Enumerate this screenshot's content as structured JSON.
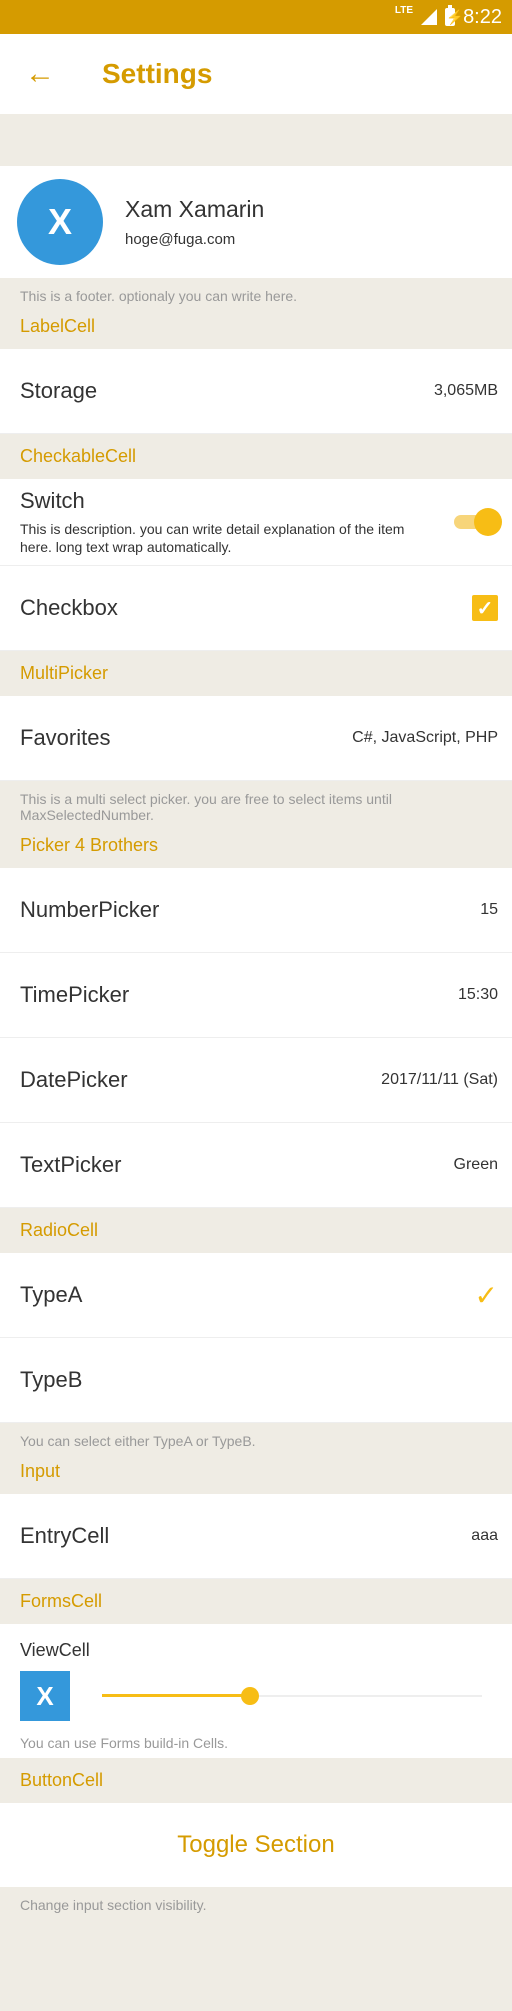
{
  "status": {
    "lte": "LTE",
    "time": "8:22"
  },
  "appbar": {
    "title": "Settings"
  },
  "profile": {
    "name": "Xam Xamarin",
    "email": "hoge@fuga.com",
    "logo_letter": "X",
    "footer": "This is a footer. optionaly you can write here."
  },
  "label_section": {
    "header": "LabelCell",
    "storage_label": "Storage",
    "storage_value": "3,065MB"
  },
  "checkable_section": {
    "header": "CheckableCell",
    "switch_label": "Switch",
    "switch_desc": "This is description. you can write detail explanation of the item here. long text wrap automatically.",
    "switch_on": true,
    "checkbox_label": "Checkbox",
    "checkbox_checked": true
  },
  "multi_section": {
    "header": "MultiPicker",
    "favorites_label": "Favorites",
    "favorites_value": "C#, JavaScript, PHP",
    "footer": "This is a multi select picker. you are free to select items until MaxSelectedNumber."
  },
  "picker_section": {
    "header": "Picker 4 Brothers",
    "items": [
      {
        "label": "NumberPicker",
        "value": "15"
      },
      {
        "label": "TimePicker",
        "value": "15:30"
      },
      {
        "label": "DatePicker",
        "value": "2017/11/11 (Sat)"
      },
      {
        "label": "TextPicker",
        "value": "Green"
      }
    ]
  },
  "radio_section": {
    "header": "RadioCell",
    "items": [
      {
        "label": "TypeA",
        "selected": true
      },
      {
        "label": "TypeB",
        "selected": false
      }
    ],
    "footer": "You can select either TypeA or TypeB."
  },
  "input_section": {
    "header": "Input",
    "entry_label": "EntryCell",
    "entry_value": "aaa"
  },
  "forms_section": {
    "header": "FormsCell",
    "viewcell_label": "ViewCell",
    "logo_letter": "X",
    "slider_value": 0.39,
    "desc": "You can use Forms build-in Cells."
  },
  "button_section": {
    "header": "ButtonCell",
    "button_label": "Toggle Section",
    "footer": "Change input section visibility."
  },
  "colors": {
    "accent": "#d59b00",
    "toggle": "#f7bd15",
    "logo_blue": "#3498db"
  }
}
